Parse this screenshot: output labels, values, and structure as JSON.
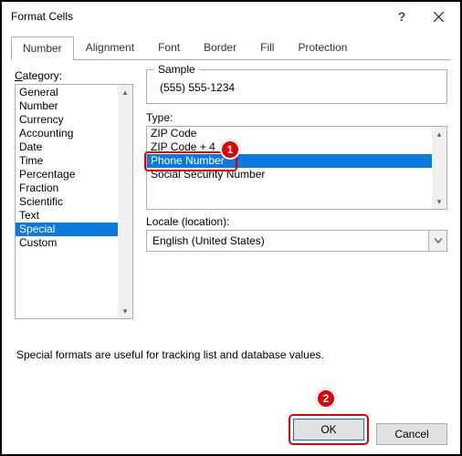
{
  "window": {
    "title": "Format Cells"
  },
  "tabs": {
    "number": "Number",
    "alignment": "Alignment",
    "font": "Font",
    "border": "Border",
    "fill": "Fill",
    "protection": "Protection"
  },
  "labels": {
    "category": "ategory:",
    "category_hot": "C",
    "sample": "Sample",
    "type": "ype:",
    "type_hot": "T",
    "locale": "ocale (location):",
    "locale_hot": "L",
    "desc": "Special formats are useful for tracking list and database values."
  },
  "category_items": [
    "General",
    "Number",
    "Currency",
    "Accounting",
    "Date",
    "Time",
    "Percentage",
    "Fraction",
    "Scientific",
    "Text",
    "Special",
    "Custom"
  ],
  "category_selected": "Special",
  "sample_value": "(555) 555-1234",
  "type_items": [
    "ZIP Code",
    "ZIP Code + 4",
    "Phone Number",
    "Social Security Number"
  ],
  "type_selected": "Phone Number",
  "locale_value": "English (United States)",
  "buttons": {
    "ok": "OK",
    "cancel": "Cancel"
  },
  "annotations": {
    "badge1": "1",
    "badge2": "2"
  }
}
